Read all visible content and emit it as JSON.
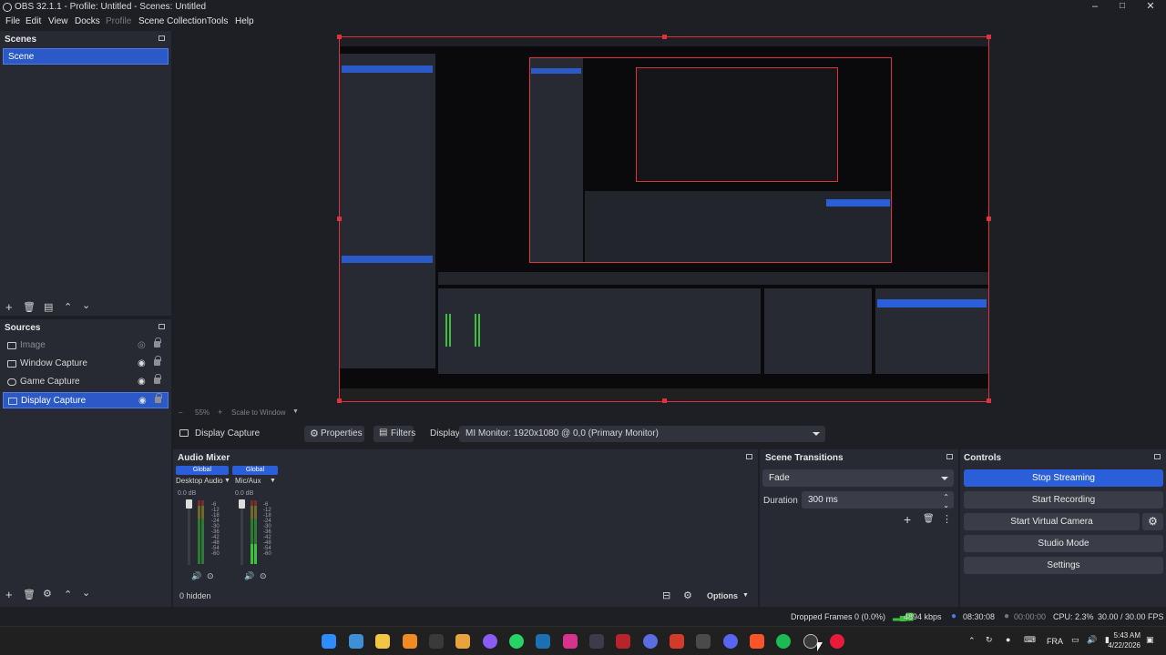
{
  "window": {
    "title": "OBS 32.1.1 - Profile: Untitled - Scenes: Untitled",
    "minimize": "–",
    "maximize": "□",
    "close": "✕"
  },
  "menu": {
    "file": "File",
    "edit": "Edit",
    "view": "View",
    "docks": "Docks",
    "profile": "Profile",
    "scene_collection": "Scene Collection",
    "tools": "Tools",
    "help": "Help"
  },
  "scenes": {
    "title": "Scenes",
    "items": [
      "Scene"
    ]
  },
  "sources": {
    "title": "Sources",
    "items": [
      {
        "label": "Image",
        "visible": false,
        "icon": "image-icon"
      },
      {
        "label": "Window Capture",
        "visible": true,
        "icon": "window-icon"
      },
      {
        "label": "Game Capture",
        "visible": true,
        "icon": "gamepad-icon"
      },
      {
        "label": "Display Capture",
        "visible": true,
        "icon": "monitor-icon"
      }
    ]
  },
  "preview_toolbar": {
    "zoom": "55%",
    "scale_mode": "Scale to Window"
  },
  "context_bar": {
    "source_name": "Display Capture",
    "properties": "Properties",
    "filters": "Filters",
    "display_label": "Display",
    "display_value": "MI Monitor: 1920x1080 @ 0,0 (Primary Monitor)"
  },
  "audio_mixer": {
    "title": "Audio Mixer",
    "channels": [
      {
        "badge": "Global",
        "name": "Desktop Audio",
        "db": "0.0 dB"
      },
      {
        "badge": "Global",
        "name": "Mic/Aux",
        "db": "0.0 dB"
      }
    ],
    "scale": [
      "-6",
      "-12",
      "-18",
      "-24",
      "-30",
      "-36",
      "-42",
      "-48",
      "-54",
      "-60"
    ],
    "hidden": "0 hidden",
    "options": "Options"
  },
  "transitions": {
    "title": "Scene Transitions",
    "selected": "Fade",
    "duration_label": "Duration",
    "duration_value": "300 ms"
  },
  "controls": {
    "title": "Controls",
    "stop_streaming": "Stop Streaming",
    "start_recording": "Start Recording",
    "start_virtual_camera": "Start Virtual Camera",
    "studio_mode": "Studio Mode",
    "settings": "Settings"
  },
  "status": {
    "dropped_frames": "Dropped Frames 0 (0.0%)",
    "bitrate": "4894 kbps",
    "stream_time": "08:30:08",
    "record_time": "00:00:00",
    "cpu": "CPU: 2.3%",
    "fps": "30.00 / 30.00 FPS"
  },
  "taskbar": {
    "language": "FRA",
    "time": "5:43 AM",
    "date": "4/22/2026"
  },
  "colors": {
    "accent": "#2b5fd9",
    "preview_border": "#e0323a",
    "meter_green": "#3fbf3f",
    "meter_yellow": "#c8c23a",
    "meter_red": "#c23636"
  }
}
